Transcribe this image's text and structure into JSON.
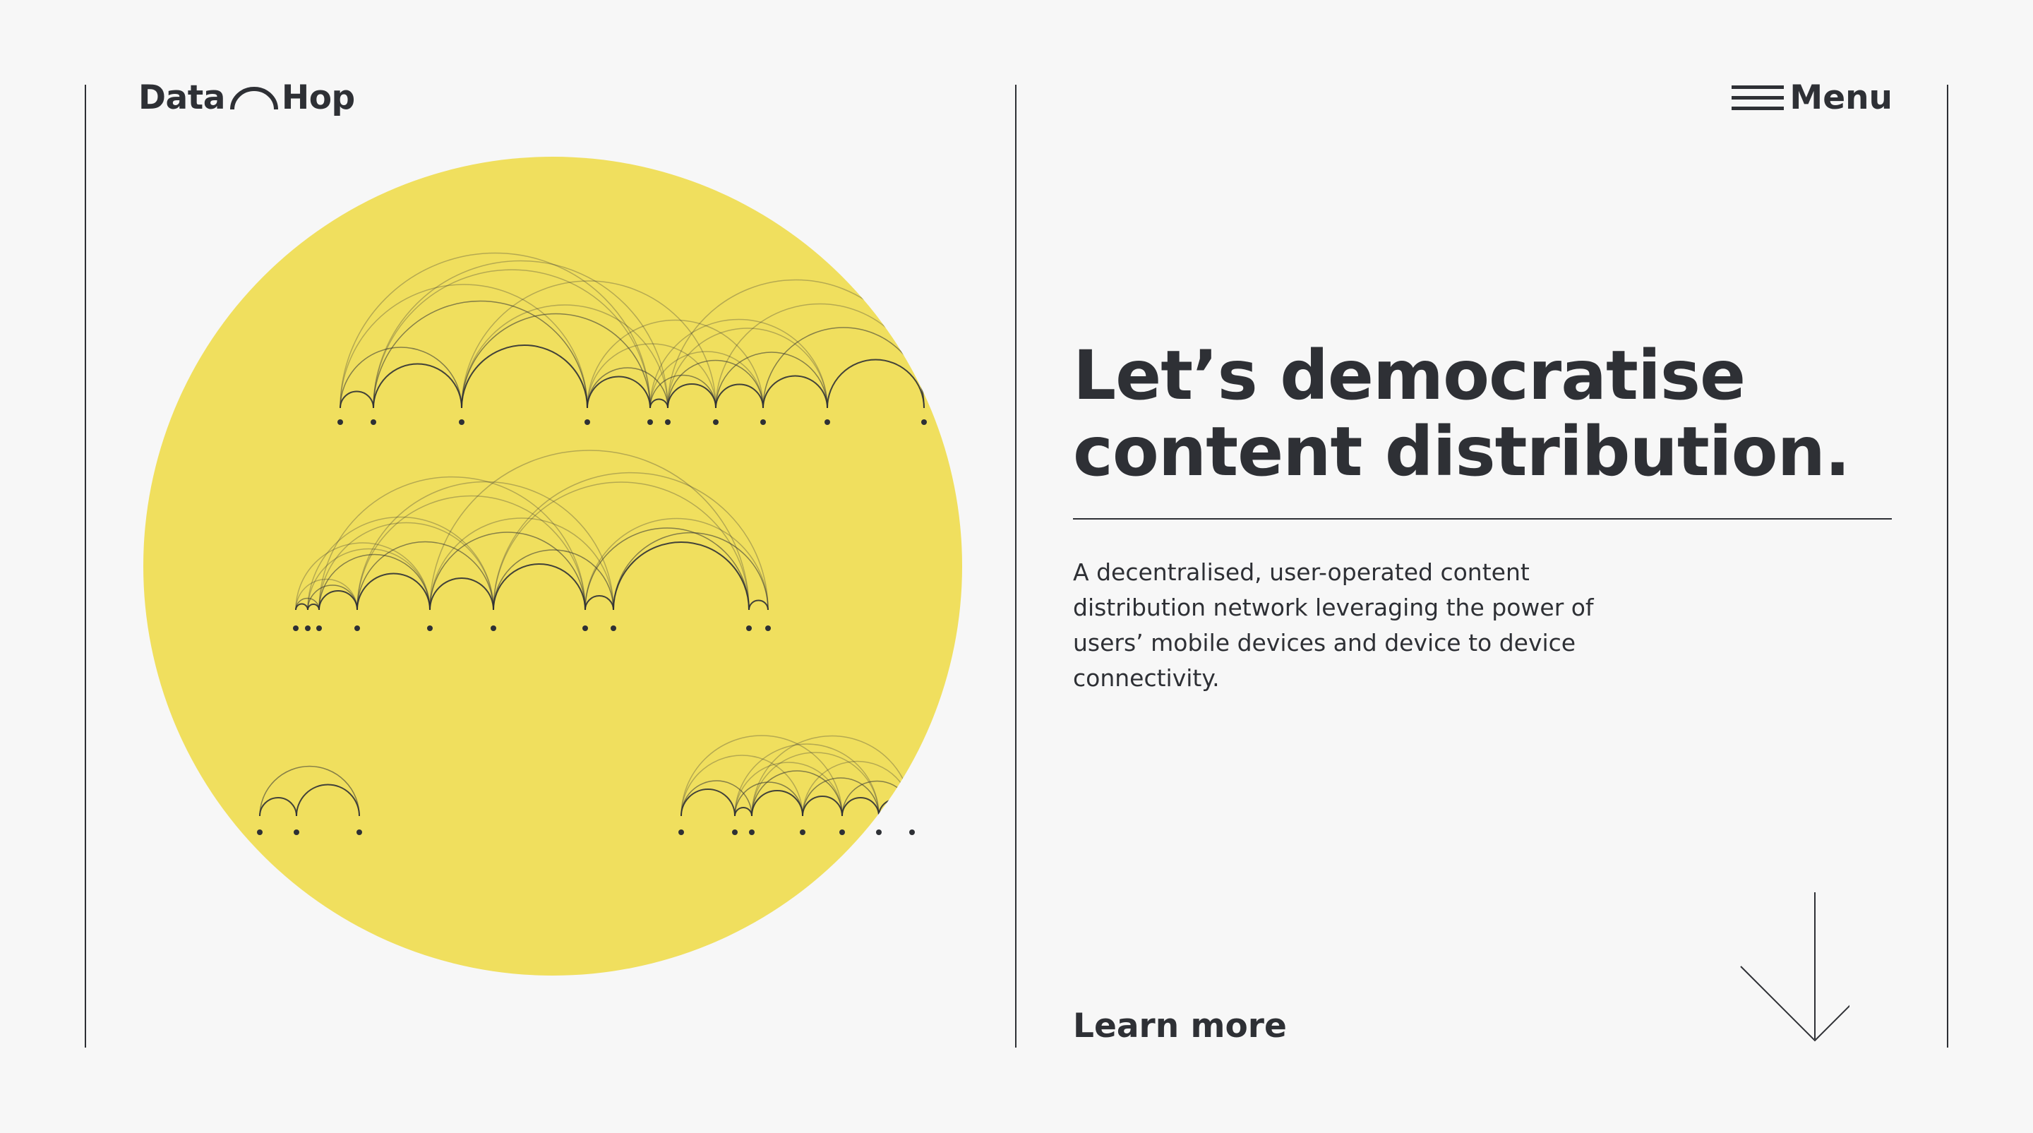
{
  "header": {
    "logo_left": "Data",
    "logo_right": "Hop",
    "logo_icon": "arch-icon",
    "menu_label": "Menu",
    "menu_icon": "hamburger-icon"
  },
  "hero": {
    "headline_line1": "Let’s democratise",
    "headline_line2": "content distribution.",
    "description_lines": [
      "A decentralised, user-operated content",
      "distribution network leveraging the power of",
      "users’ mobile devices and device to device",
      "connectivity."
    ],
    "cta_label": "Learn more",
    "scroll_icon": "arrow-down-icon"
  },
  "colors": {
    "background": "#f7f7f7",
    "text": "#2e3035",
    "accent_yellow": "#f0df5e"
  }
}
